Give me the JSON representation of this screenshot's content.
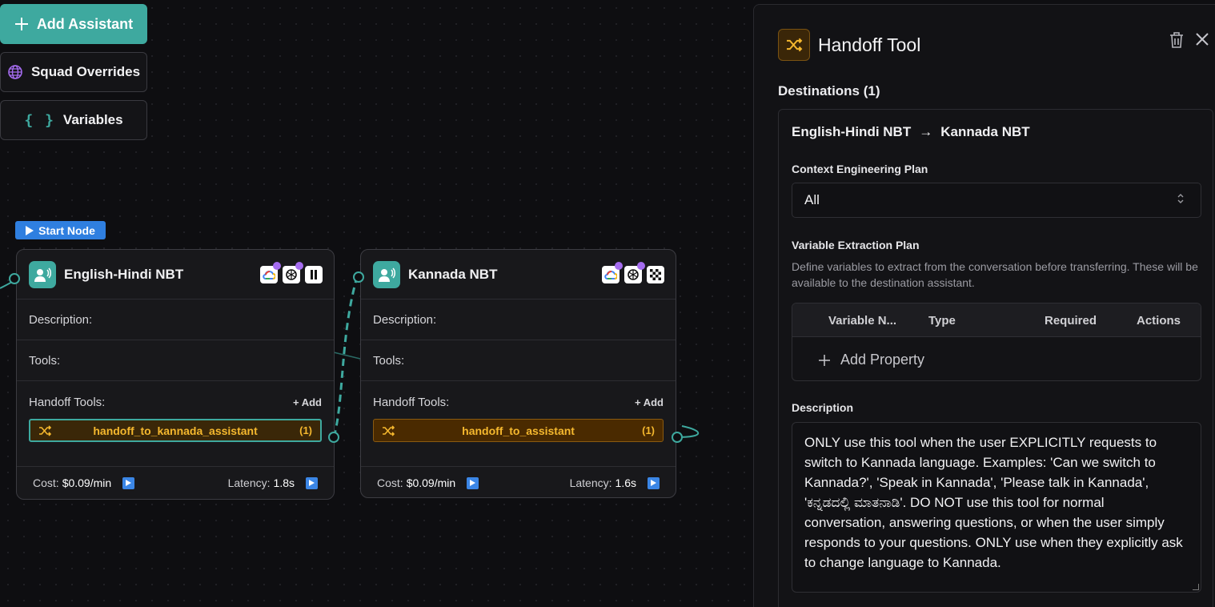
{
  "toolbar": {
    "add_assistant": "Add Assistant",
    "squad_overrides": "Squad Overrides",
    "variables_glyph": "{ }",
    "variables": "Variables"
  },
  "start_badge": "Start Node",
  "nodes": [
    {
      "title": "English-Hindi NBT",
      "description_label": "Description:",
      "tools_label": "Tools:",
      "handoff_label": "Handoff Tools:",
      "add_label": "+ Add",
      "handoff_tool": {
        "name": "handoff_to_kannada_assistant",
        "count": "(1)",
        "selected": true
      },
      "cost_label": "Cost:",
      "cost_value": "$0.09/min",
      "latency_label": "Latency:",
      "latency_value": "1.8s",
      "icons": [
        "google-cloud-icon",
        "openai-icon",
        "voice-provider-icon"
      ]
    },
    {
      "title": "Kannada NBT",
      "description_label": "Description:",
      "tools_label": "Tools:",
      "handoff_label": "Handoff Tools:",
      "add_label": "+ Add",
      "handoff_tool": {
        "name": "handoff_to_assistant",
        "count": "(1)",
        "selected": false
      },
      "cost_label": "Cost:",
      "cost_value": "$0.09/min",
      "latency_label": "Latency:",
      "latency_value": "1.6s",
      "icons": [
        "google-cloud-icon",
        "openai-icon",
        "checkered-icon"
      ]
    }
  ],
  "panel": {
    "title": "Handoff Tool",
    "destinations_label": "Destinations (1)",
    "route_from": "English-Hindi NBT",
    "route_arrow": "→",
    "route_to": "Kannada NBT",
    "context_label": "Context Engineering Plan",
    "context_value": "All",
    "variable_label": "Variable Extraction Plan",
    "variable_help": "Define variables to extract from the conversation before transferring. These will be available to the destination assistant.",
    "table_headers": [
      "Variable N...",
      "Type",
      "Required",
      "Actions"
    ],
    "add_property": "Add Property",
    "description_label": "Description",
    "description_value": "ONLY use this tool when the user EXPLICITLY requests to switch to Kannada language. Examples: 'Can we switch to Kannada?', 'Speak in Kannada', 'Please talk in Kannada', 'ಕನ್ನಡದಲ್ಲಿ ಮಾತನಾಡಿ'. DO NOT use this tool for normal conversation, answering questions, or when the user simply responds to your questions. ONLY use when they explicitly ask to change language to Kannada."
  },
  "colors": {
    "accent": "#3ea99f",
    "handoff": "#f5b82e",
    "start": "#2f7fe0"
  }
}
